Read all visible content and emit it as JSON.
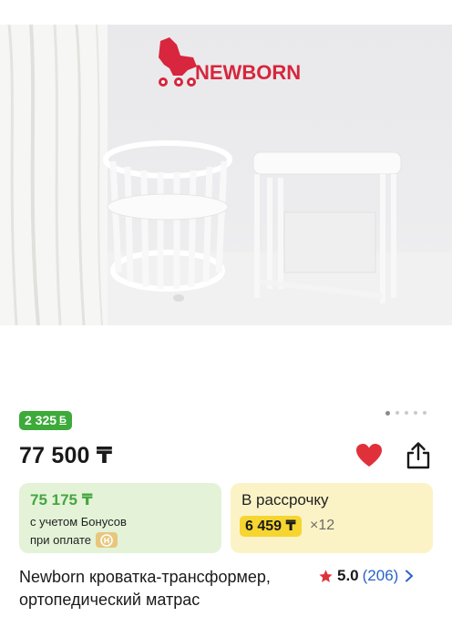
{
  "product": {
    "brand_logo_text": "NEWBORN",
    "bonus_amount": "2 325",
    "bonus_symbol": "Б",
    "price": "77 500 ₸",
    "bonus_card": {
      "price": "75 175 ₸",
      "line1": "с учетом Бонусов",
      "line2": "при оплате"
    },
    "installment_card": {
      "title": "В рассрочку",
      "monthly": "6 459 ₸",
      "multiplier": "×12"
    },
    "title": "Newborn кроватка-трансформер, ортопедический матрас",
    "rating": {
      "score": "5.0",
      "count": "(206)"
    },
    "gallery": {
      "total": 5,
      "active": 0
    }
  },
  "icons": {
    "heart": "heart-icon",
    "share": "share-icon",
    "star": "star-icon",
    "chevron": "chevron-right-icon",
    "payment": "payment-logo-icon"
  },
  "colors": {
    "bonus_green": "#3daa3a",
    "heart_red": "#e0313a",
    "installment_yellow": "#f7d531",
    "link_blue": "#2962c8"
  }
}
